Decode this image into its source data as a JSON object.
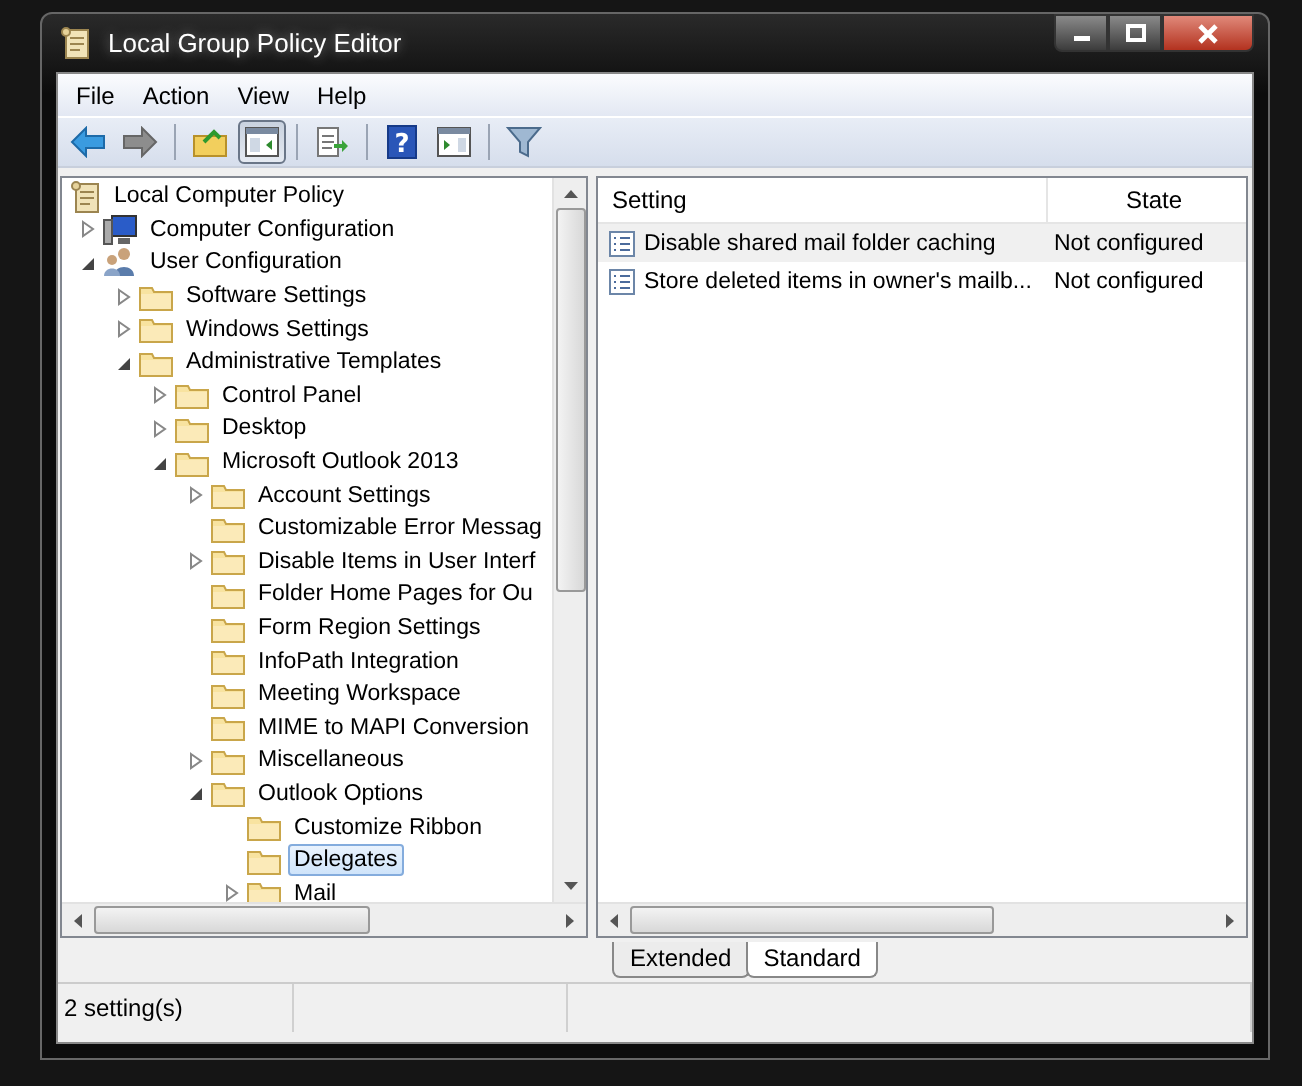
{
  "window": {
    "title": "Local Group Policy Editor"
  },
  "menu": [
    "File",
    "Action",
    "View",
    "Help"
  ],
  "toolbar": [
    [
      {
        "kind": "back",
        "pressed": false
      },
      {
        "kind": "forward",
        "pressed": false
      }
    ],
    [
      {
        "kind": "up",
        "pressed": false
      },
      {
        "kind": "tree-pane",
        "pressed": true
      }
    ],
    [
      {
        "kind": "export",
        "pressed": false
      }
    ],
    [
      {
        "kind": "help",
        "label": "?",
        "pressed": false
      },
      {
        "kind": "action-pane",
        "pressed": false
      }
    ],
    [
      {
        "kind": "filter",
        "pressed": false
      }
    ]
  ],
  "tree": [
    {
      "label": "Local Computer Policy",
      "kind": "policy",
      "selected": false,
      "children": [
        {
          "label": "Computer Configuration",
          "kind": "computer",
          "expanded": false,
          "selected": false
        },
        {
          "label": "User Configuration",
          "kind": "users",
          "expanded": true,
          "selected": false,
          "children": [
            {
              "label": "Software Settings",
              "kind": "folder",
              "expanded": false,
              "selected": false
            },
            {
              "label": "Windows Settings",
              "kind": "folder",
              "expanded": false,
              "selected": false
            },
            {
              "label": "Administrative Templates",
              "kind": "folder",
              "expanded": true,
              "selected": false,
              "children": [
                {
                  "label": "Control Panel",
                  "kind": "folder",
                  "expanded": false,
                  "selected": false
                },
                {
                  "label": "Desktop",
                  "kind": "folder",
                  "expanded": false,
                  "selected": false
                },
                {
                  "label": "Microsoft Outlook 2013",
                  "kind": "folder",
                  "expanded": true,
                  "selected": false,
                  "children": [
                    {
                      "label": "Account Settings",
                      "kind": "folder",
                      "expanded": false,
                      "selected": false
                    },
                    {
                      "label": "Customizable Error Messag",
                      "kind": "folder",
                      "selected": false
                    },
                    {
                      "label": "Disable Items in User Interf",
                      "kind": "folder",
                      "expanded": false,
                      "selected": false
                    },
                    {
                      "label": "Folder Home Pages for Ou",
                      "kind": "folder",
                      "selected": false
                    },
                    {
                      "label": "Form Region Settings",
                      "kind": "folder",
                      "selected": false
                    },
                    {
                      "label": "InfoPath Integration",
                      "kind": "folder",
                      "selected": false
                    },
                    {
                      "label": "Meeting Workspace",
                      "kind": "folder",
                      "selected": false
                    },
                    {
                      "label": "MIME to MAPI Conversion",
                      "kind": "folder",
                      "selected": false
                    },
                    {
                      "label": "Miscellaneous",
                      "kind": "folder",
                      "expanded": false,
                      "selected": false
                    },
                    {
                      "label": "Outlook Options",
                      "kind": "folder",
                      "expanded": true,
                      "selected": false,
                      "children": [
                        {
                          "label": "Customize Ribbon",
                          "kind": "folder",
                          "selected": false
                        },
                        {
                          "label": "Delegates",
                          "kind": "folder",
                          "selected": true
                        },
                        {
                          "label": "Mail",
                          "kind": "folder",
                          "expanded": false,
                          "selected": false
                        }
                      ]
                    }
                  ]
                }
              ]
            }
          ]
        }
      ]
    }
  ],
  "table": {
    "columns": [
      "Setting",
      "State"
    ],
    "rows": [
      {
        "setting": "Disable shared mail folder caching",
        "state": "Not configured",
        "selected": true
      },
      {
        "setting": "Store deleted items in owner's mailb...",
        "state": "Not configured",
        "selected": false
      }
    ]
  },
  "tabs": [
    {
      "label": "Extended",
      "selected": false
    },
    {
      "label": "Standard",
      "selected": true
    }
  ],
  "status_bar": "2 setting(s)"
}
